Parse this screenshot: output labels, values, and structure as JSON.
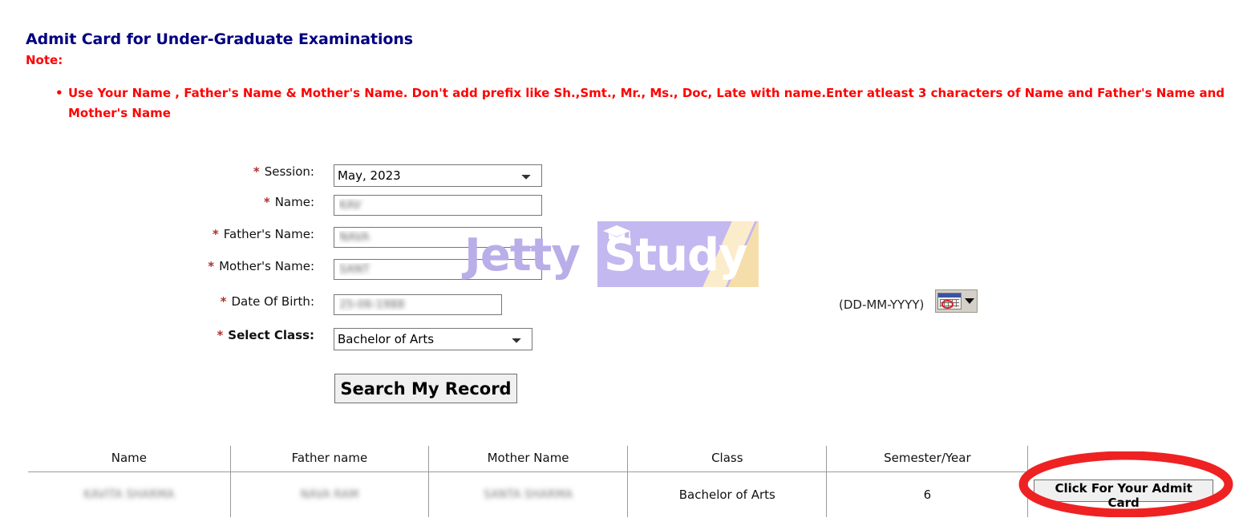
{
  "header": {
    "title": "Admit Card for Under-Graduate Examinations",
    "note_label": "Note:",
    "note_items": [
      "Use Your Name , Father's Name & Mother's Name. Don't add prefix like Sh.,Smt., Mr., Ms., Doc, Late with name.Enter atleast 3 characters of Name and Father's Name and Mother's Name"
    ]
  },
  "form": {
    "required_marker": "*",
    "fields": {
      "session": {
        "label": "Session:",
        "value": "May, 2023",
        "options": [
          "May, 2023"
        ]
      },
      "name": {
        "label": "Name:",
        "value": "KAV",
        "placeholder": ""
      },
      "father_name": {
        "label": "Father's Name:",
        "value": "NAVA",
        "placeholder": ""
      },
      "mother_name": {
        "label": "Mother's Name:",
        "value": "SANT",
        "placeholder": ""
      },
      "dob": {
        "label": "Date Of Birth:",
        "value": "25-06-1988",
        "hint": "(DD-MM-YYYY)",
        "placeholder": ""
      },
      "select_class": {
        "label": "Select Class:",
        "value": "Bachelor of Arts",
        "options": [
          "Bachelor of Arts"
        ]
      }
    },
    "search_button": "Search My Record",
    "calendar_icon": "calendar-icon",
    "calendar_dropdown_icon": "chevron-down-icon"
  },
  "watermark": {
    "text_left": "Jetty",
    "text_right": "Study",
    "cap_icon": "graduation-cap-icon",
    "color_left": "#b9aee8",
    "color_block": "#c3b8ef",
    "color_stripe": "#f6deab"
  },
  "results": {
    "columns": [
      "Name",
      "Father name",
      "Mother Name",
      "Class",
      "Semester/Year",
      ""
    ],
    "rows": [
      {
        "name": "KAVITA SHARMA",
        "father_name": "NAVA RAM",
        "mother_name": "SANTA SHARMA",
        "class": "Bachelor of Arts",
        "semester_year": "6",
        "action_label": "Click For Your Admit Card"
      }
    ]
  },
  "annotation": {
    "shape": "ellipse-highlight",
    "color": "#ee2222"
  },
  "colors": {
    "title": "#000080",
    "note": "#ff0000",
    "required": "#b03030",
    "annotation": "#ee2222"
  }
}
